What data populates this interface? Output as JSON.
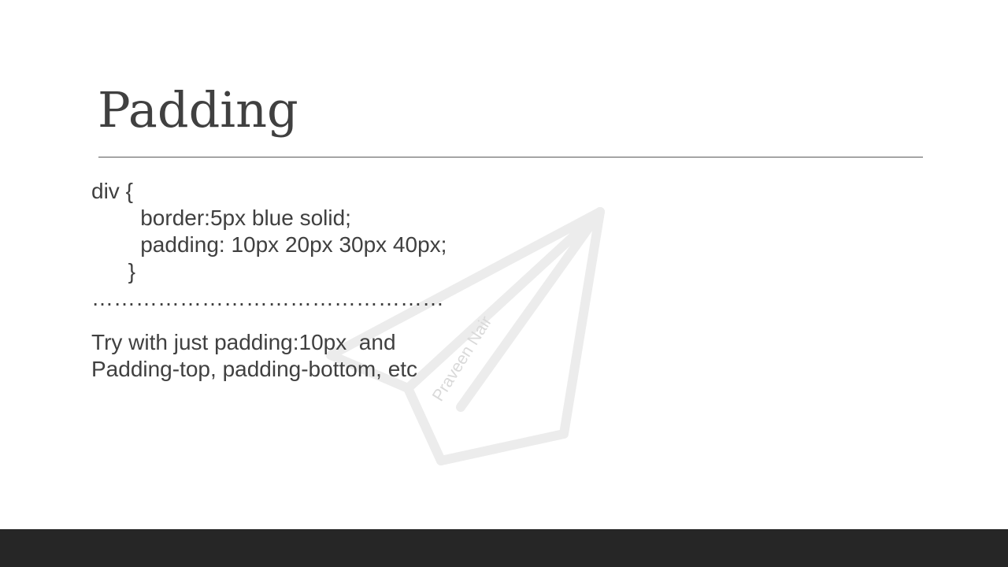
{
  "slide": {
    "title": "Padding",
    "code_lines": [
      "div {",
      "        border:5px blue solid;",
      "        padding: 10px 20px 30px 40px;",
      "      }"
    ],
    "separator": "…………………………………………",
    "note_lines": [
      "Try with just padding:10px  and",
      "Padding-top, padding-bottom, etc"
    ]
  },
  "watermark": {
    "text": "Praveen Nair",
    "icon": "paper-plane-icon"
  },
  "colors": {
    "text": "#404040",
    "rule": "#595959",
    "footer": "#262626",
    "watermark": "#e6e6e6"
  }
}
